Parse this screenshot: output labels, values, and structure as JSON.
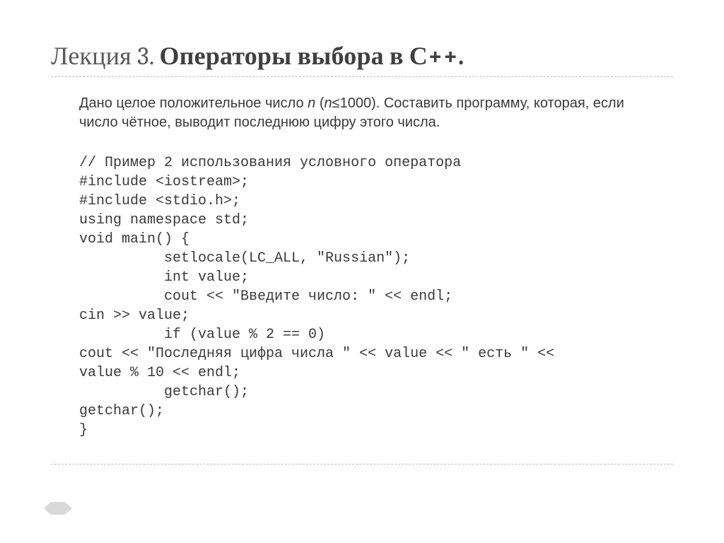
{
  "title_prefix": "Лекция 3. ",
  "title_bold": "Операторы выбора в С++.",
  "problem_a": "Дано целое  положительное число ",
  "problem_n": "n",
  "problem_b": " (",
  "problem_n2": "n",
  "problem_c": "≤1000). Составить программу, которая, если число чётное, выводит последнюю цифру этого числа.",
  "code": "// Пример 2 использования условного оператора\n#include <iostream>;\n#include <stdio.h>;\nusing namespace std;\nvoid main() {\n          setlocale(LC_ALL, \"Russian\");\n          int value;\n          cout << \"Введите число: \" << endl;\ncin >> value;\n          if (value % 2 == 0)\ncout << \"Последняя цифра числа \" << value << \" есть \" <<\nvalue % 10 << endl;\n          getchar();\ngetchar();\n}"
}
